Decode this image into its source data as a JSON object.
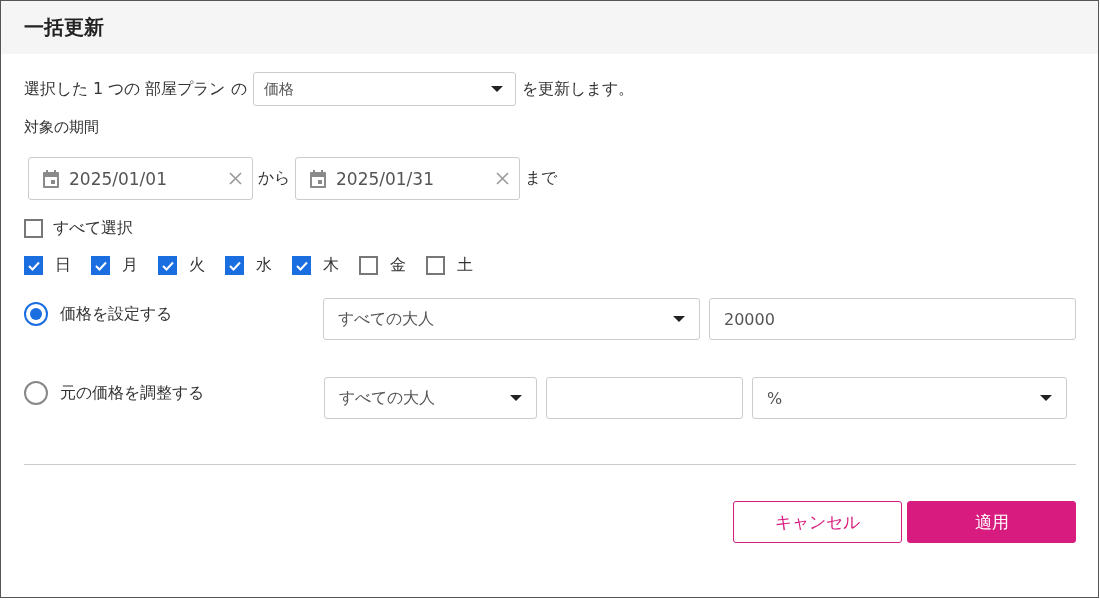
{
  "dialog": {
    "title": "一括更新"
  },
  "intro": {
    "prefix": "選択した 1 つの 部屋プラン の",
    "field_select": {
      "value": "価格"
    },
    "suffix": "を更新します。"
  },
  "period": {
    "label": "対象の期間",
    "start": {
      "value": "2025/01/01"
    },
    "connector": "から",
    "end": {
      "value": "2025/01/31"
    },
    "suffix": "まで"
  },
  "select_all": {
    "label": "すべて選択",
    "checked": false
  },
  "weekdays": [
    {
      "label": "日",
      "checked": true
    },
    {
      "label": "月",
      "checked": true
    },
    {
      "label": "火",
      "checked": true
    },
    {
      "label": "水",
      "checked": true
    },
    {
      "label": "木",
      "checked": true
    },
    {
      "label": "金",
      "checked": false
    },
    {
      "label": "土",
      "checked": false
    }
  ],
  "price_options": [
    {
      "label": "価格を設定する",
      "selected": true,
      "fields": [
        {
          "kind": "select",
          "value": "すべての大人"
        },
        {
          "kind": "input",
          "value": "20000"
        }
      ]
    },
    {
      "label": "元の価格を調整する",
      "selected": false,
      "fields": [
        {
          "kind": "select",
          "value": "すべての大人"
        },
        {
          "kind": "input"
        },
        {
          "kind": "select",
          "value": "%"
        }
      ]
    }
  ],
  "buttons": [
    {
      "label": "キャンセル",
      "kind": "secondary"
    },
    {
      "label": "適用",
      "kind": "primary"
    }
  ]
}
